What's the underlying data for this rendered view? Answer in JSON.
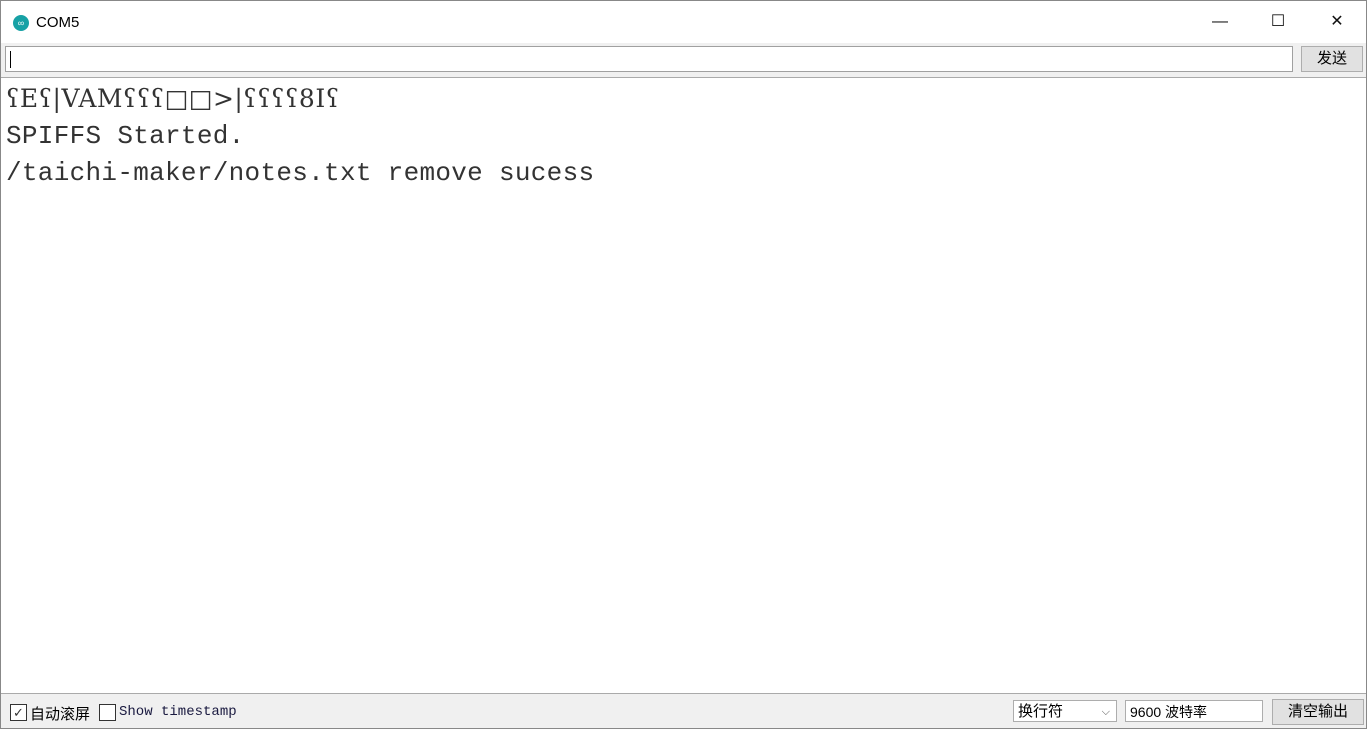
{
  "window": {
    "title": "COM5",
    "icon": "arduino-icon",
    "controls": {
      "minimize": "—",
      "maximize": "☐",
      "close": "✕"
    }
  },
  "send_row": {
    "input_value": "",
    "send_label": "发送"
  },
  "output": {
    "lines": [
      "ʕEʕ|VAMʕʕʕ□□>|ʕʕʕʕ8Iʕ",
      "SPIFFS Started.",
      "/taichi-maker/notes.txt remove sucess"
    ]
  },
  "bottom": {
    "autoscroll_label": "自动滚屏",
    "autoscroll_checked": true,
    "timestamp_label": "Show timestamp",
    "timestamp_checked": false,
    "line_ending": "换行符",
    "baud_rate": "9600 波特率",
    "clear_label": "清空输出"
  }
}
